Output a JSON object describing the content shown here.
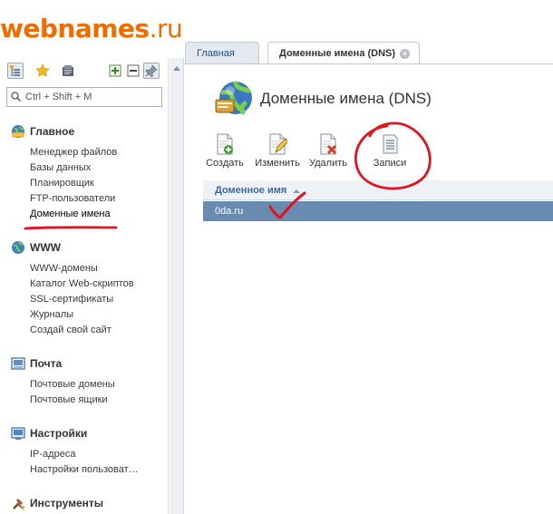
{
  "logo": {
    "part1": "webnames",
    "part2": ".ru"
  },
  "left_panel": {
    "search_placeholder": "Ctrl + Shift + M",
    "sections": [
      {
        "title": "Главное",
        "icon": "home-globe-icon",
        "items": [
          "Менеджер файлов",
          "Базы данных",
          "Планировщик",
          "FTP-пользователи",
          "Доменные имена"
        ]
      },
      {
        "title": "WWW",
        "icon": "www-globe-icon",
        "items": [
          "WWW-домены",
          "Каталог Web-скриптов",
          "SSL-сертификаты",
          "Журналы",
          "Создай свой сайт"
        ]
      },
      {
        "title": "Почта",
        "icon": "mail-icon",
        "items": [
          "Почтовые домены",
          "Почтовые ящики"
        ]
      },
      {
        "title": "Настройки",
        "icon": "settings-icon",
        "items": [
          "IP-адреса",
          "Настройки пользоват…"
        ]
      },
      {
        "title": "Инструменты",
        "icon": "tools-icon",
        "items": []
      }
    ]
  },
  "tabs": [
    {
      "label": "Главная"
    },
    {
      "label": "Доменные имена (DNS)"
    }
  ],
  "page": {
    "title": "Доменные имена (DNS)",
    "actions": [
      {
        "label": "Создать",
        "icon": "create-icon"
      },
      {
        "label": "Изменить",
        "icon": "edit-icon"
      },
      {
        "label": "Удалить",
        "icon": "delete-icon"
      },
      {
        "label": "Записи",
        "icon": "records-icon"
      }
    ],
    "table": {
      "column": "Доменное имя",
      "rows": [
        "0da.ru"
      ]
    }
  },
  "colors": {
    "brand": "#ef6c00",
    "selected_row": "#6a8bb0",
    "annotation": "#e0141e"
  }
}
